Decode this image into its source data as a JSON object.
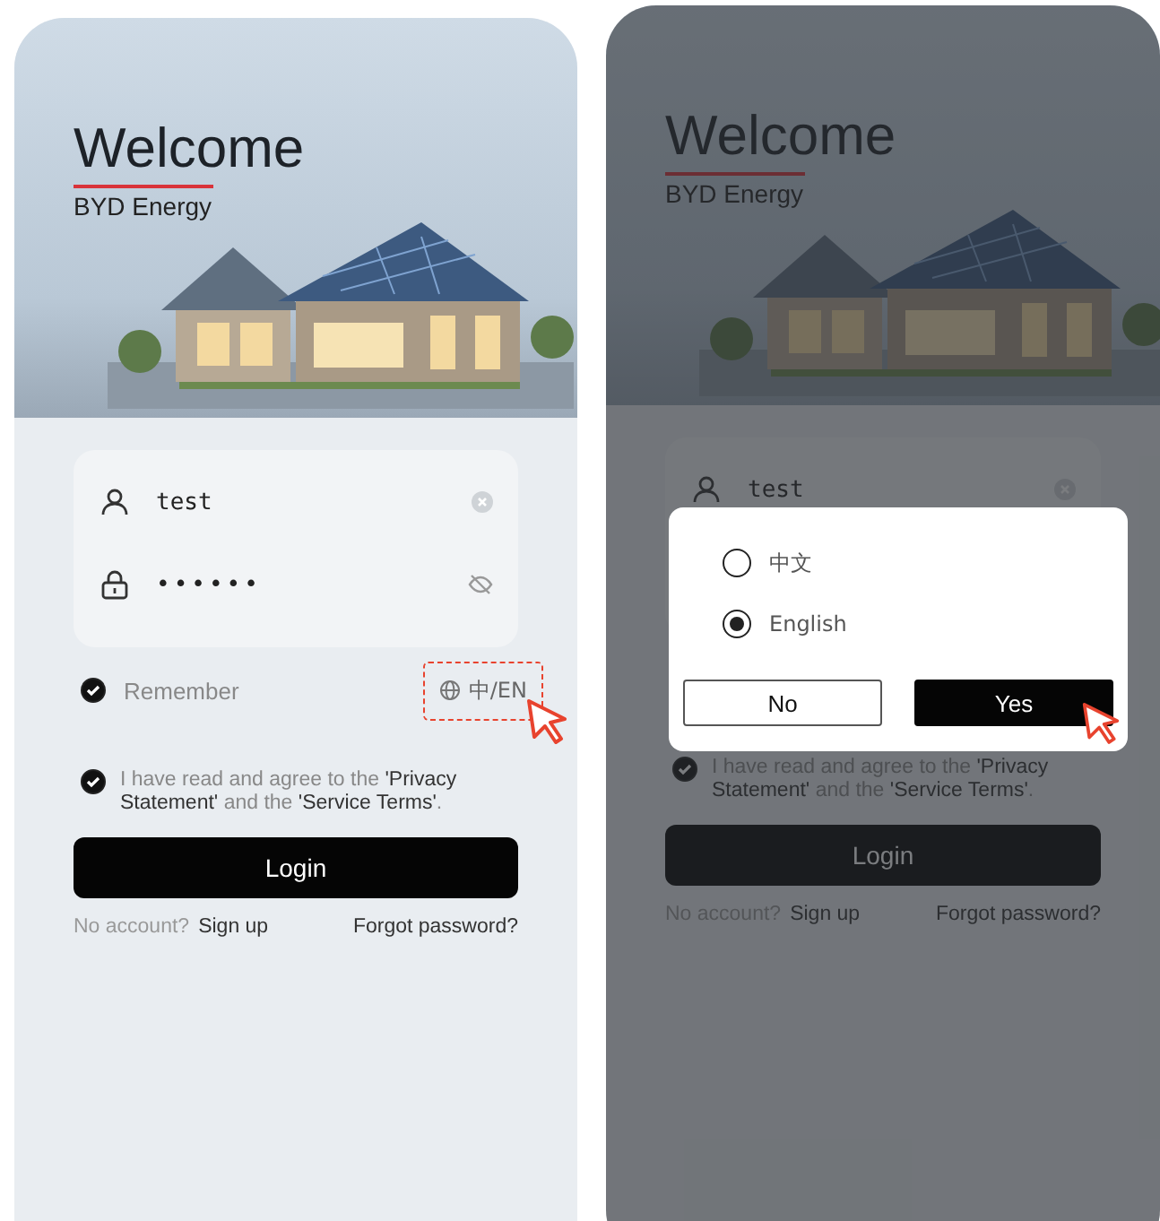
{
  "screens": [
    {
      "title": "Welcome",
      "brand": "BYD Energy",
      "username": "test",
      "password": "••••••",
      "remember": {
        "label": "Remember",
        "checked": true
      },
      "language_toggle": {
        "label": "中/EN",
        "highlighted": true
      },
      "agreement": {
        "text": "I have read and agree to the **'Privacy Statement'** and the **'Service Terms'**.",
        "checked": true
      },
      "login_button": "Login",
      "no_account": "No account?",
      "sign_up": "Sign up",
      "forgot_password": "Forgot password?"
    },
    {
      "title": "Welcome",
      "brand": "BYD Energy",
      "username": "test",
      "agreement": {
        "text": "I have read and agree to the **'Privacy Statement'** and the **'Service Terms'**.",
        "checked": true
      },
      "login_button": "Login",
      "no_account": "No account?",
      "sign_up": "Sign up",
      "forgot_password": "Forgot password?",
      "dialog": {
        "options": [
          {
            "label": "中文",
            "selected": false
          },
          {
            "label": "English",
            "selected": true
          }
        ],
        "buttons": [
          {
            "label": "No",
            "kind": "secondary",
            "pointer": false
          },
          {
            "label": "Yes",
            "kind": "primary",
            "pointer": true
          }
        ]
      }
    }
  ]
}
